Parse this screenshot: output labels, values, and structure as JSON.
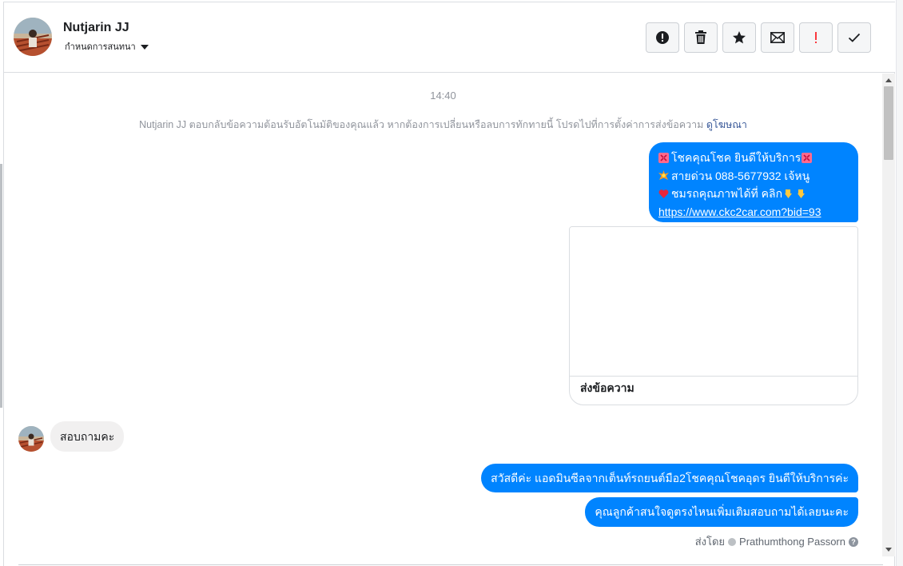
{
  "header": {
    "contact_name": "Nutjarin JJ",
    "conversation_control": "กำหนดการสนทนา",
    "toolbar": [
      {
        "name": "spam-alert-button",
        "icon": "alert-circle-icon",
        "color": "#1c1e21"
      },
      {
        "name": "delete-button",
        "icon": "trash-icon",
        "color": "#1c1e21"
      },
      {
        "name": "star-button",
        "icon": "star-icon",
        "color": "#1c1e21"
      },
      {
        "name": "mark-unread-button",
        "icon": "envelope-icon",
        "color": "#1c1e21"
      },
      {
        "name": "follow-up-button",
        "icon": "exclamation-icon",
        "color": "#fa383e"
      },
      {
        "name": "mark-done-button",
        "icon": "check-icon",
        "color": "#1c1e21"
      }
    ]
  },
  "thread": {
    "timestamp": "14:40",
    "notice": {
      "text": "Nutjarin JJ ตอบกลับข้อความต้อนรับอัตโนมัติของคุณแล้ว หากต้องการเปลี่ยนหรือลบการทักทายนี้ โปรดไปที่การตั้งค่าการส่งข้อความ",
      "link": "ดูโฆษณา"
    },
    "auto_message": {
      "line1": "โชคคุณโชค ยินดีให้บริการ",
      "line2": "สายด่วน 088-5677932 เจ้หนู",
      "line3": "ชมรถคุณภาพได้ที่   คลิก",
      "url": "https://www.ckc2car.com?bid=93"
    },
    "card": {
      "button_label": "ส่งข้อความ"
    },
    "incoming_message": "สอบถามคะ",
    "outgoing_messages": [
      "สวัสดีค่ะ แอดมินซีลจากเต็นท์รถยนต์มือ2โชคคุณโชคอุดร ยินดีให้บริการค่ะ",
      "คุณลูกค้าสนใจดูตรงไหนเพิ่มเติมสอบถามได้เลยนะคะ"
    ],
    "sent_by": {
      "prefix": "ส่งโดย",
      "name": "Prathumthong Passorn"
    }
  },
  "colors": {
    "outgoing_bubble": "#0084ff",
    "incoming_bubble": "#f1f0f0",
    "link": "#385898"
  }
}
